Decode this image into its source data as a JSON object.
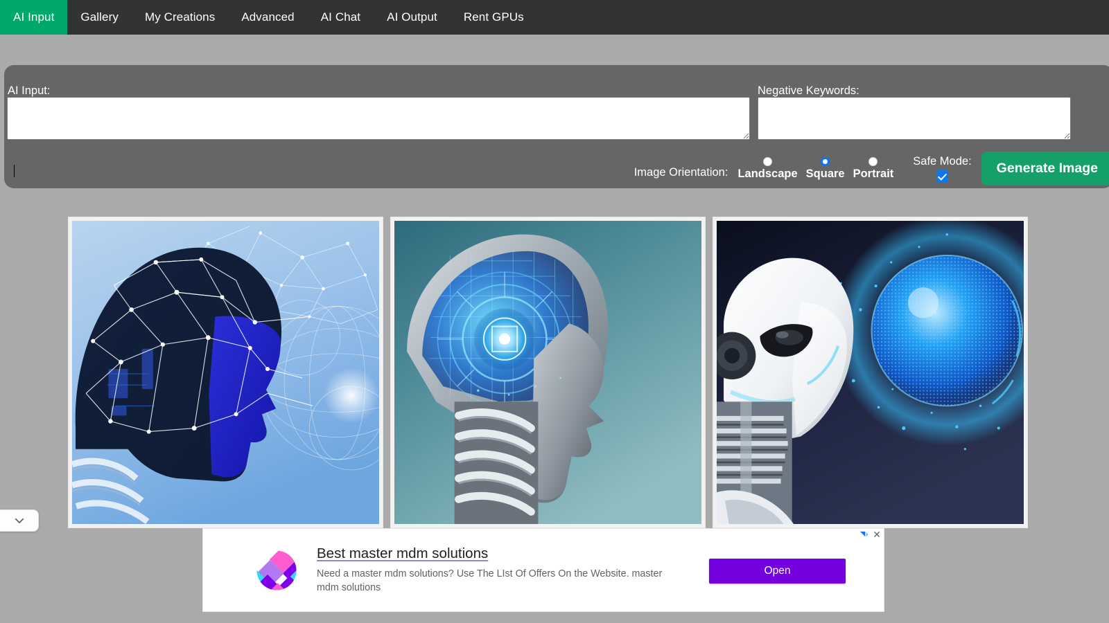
{
  "navbar": {
    "items": [
      {
        "label": "AI Input",
        "active": true
      },
      {
        "label": "Gallery",
        "active": false
      },
      {
        "label": "My Creations",
        "active": false
      },
      {
        "label": "Advanced",
        "active": false
      },
      {
        "label": "AI Chat",
        "active": false
      },
      {
        "label": "AI Output",
        "active": false
      },
      {
        "label": "Rent GPUs",
        "active": false
      }
    ],
    "active_color": "#00a86b",
    "background_color": "#333333"
  },
  "form": {
    "ai_input_label": "AI Input:",
    "ai_input_value": "",
    "negative_keywords_label": "Negative Keywords:",
    "negative_keywords_value": "",
    "orientation_label": "Image Orientation:",
    "orientation_options": [
      {
        "label": "Landscape",
        "selected": false
      },
      {
        "label": "Square",
        "selected": true
      },
      {
        "label": "Portrait",
        "selected": false
      }
    ],
    "safe_mode_label": "Safe Mode:",
    "safe_mode_checked": true,
    "generate_button_label": "Generate Image",
    "generate_button_color": "#15a06a",
    "panel_color": "#666666"
  },
  "results": {
    "images": [
      {
        "alt": "Blue AI robot head in profile with white neural network mesh overlay on light blue gradient background"
      },
      {
        "alt": "Silver chrome android head in profile with glowing cyan circuit brain on teal gradient background"
      },
      {
        "alt": "White humanoid robot facing a glowing blue particle sphere on dark navy background"
      }
    ]
  },
  "collapse_tab": {
    "icon": "chevron-down-icon"
  },
  "ad": {
    "title": "Best master mdm solutions",
    "description": "Need a master mdm solutions? Use The LIst Of Offers On the Website. master mdm solutions",
    "cta_label": "Open",
    "cta_color": "#7500e0",
    "close_label": "✕",
    "adchoices_icon": "adchoices-icon"
  },
  "page": {
    "background_color": "#aaaaaa"
  }
}
